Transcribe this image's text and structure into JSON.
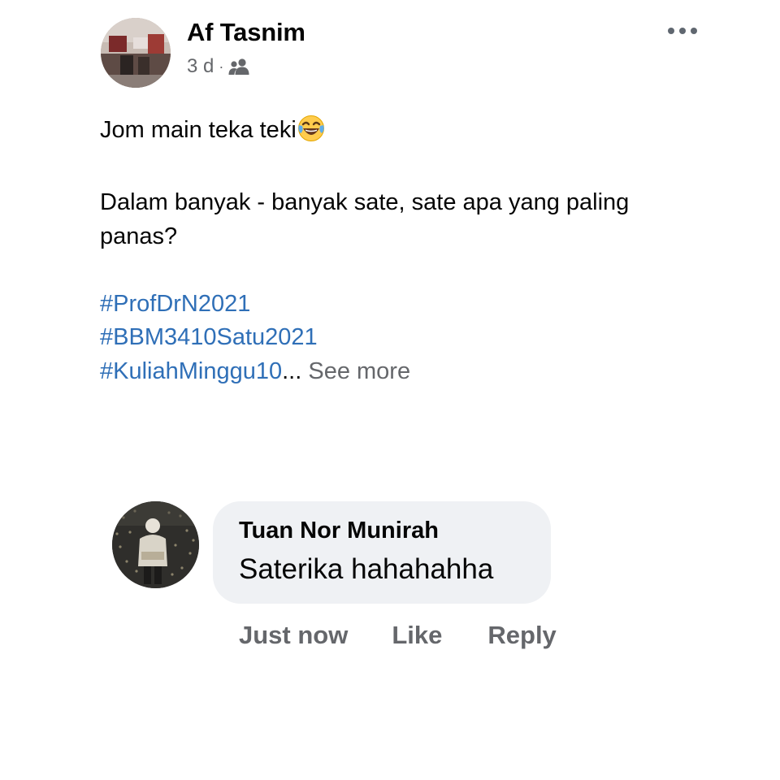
{
  "post": {
    "author": "Af Tasnim",
    "time": "3 d",
    "meta_separator": "·",
    "audience_icon": "friends-icon",
    "more_icon": "more-horizontal-icon",
    "lines": {
      "l1": "Jom main teka teki",
      "l2": "Dalam banyak - banyak sate, sate apa yang paling",
      "l3": "panas?"
    },
    "emoji": "face-with-tears-of-joy-icon",
    "hashtags": [
      "#ProfDrN2021",
      "#BBM3410Satu2021",
      "#KuliahMinggu10"
    ],
    "ellipsis": "...",
    "see_more": "See more"
  },
  "comment": {
    "author": "Tuan Nor Munirah",
    "text": "Saterika hahahahha",
    "time": "Just now",
    "like_label": "Like",
    "reply_label": "Reply"
  },
  "colors": {
    "hashtag": "#2f6fb7",
    "secondary_text": "#65676b",
    "bubble": "#eff1f4"
  }
}
